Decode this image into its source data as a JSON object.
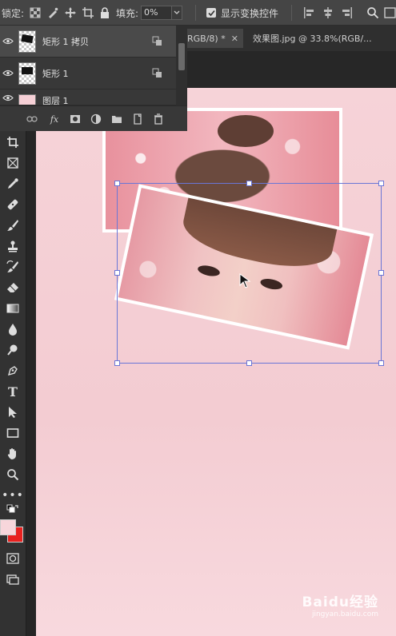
{
  "options_bar": {
    "lock_label": "锁定:",
    "fill_label": "填充:",
    "fill_value": "0%",
    "show_transform_label": "显示变换控件",
    "show_transform_checked": true
  },
  "tabs": [
    {
      "label": "RGB/8) *",
      "active": true
    },
    {
      "label": "效果图.jpg @ 33.8%(RGB/...",
      "active": false
    }
  ],
  "layers": [
    {
      "name": "矩形 1 拷贝",
      "selected": true
    },
    {
      "name": "矩形 1",
      "selected": false
    },
    {
      "name": "图层 1",
      "selected": false
    }
  ],
  "layer_footer_icons": [
    "link-icon",
    "fx-icon",
    "mask-icon",
    "adjustment-icon",
    "folder-icon",
    "new-layer-icon",
    "trash-icon"
  ],
  "tools": [
    "crop-icon",
    "frame-icon",
    "eyedropper-icon",
    "healing-brush-icon",
    "brush-icon",
    "clone-stamp-icon",
    "history-brush-icon",
    "eraser-icon",
    "gradient-icon",
    "blur-icon",
    "dodge-icon",
    "pen-icon",
    "type-icon",
    "path-select-icon",
    "rectangle-icon",
    "hand-icon",
    "zoom-icon",
    "more-icon"
  ],
  "colors": {
    "foreground": "#f7d6db",
    "background": "#e8211f",
    "canvas": "#f5cfd5",
    "selection": "#6a76d6"
  },
  "watermark": {
    "brand": "Baidu经验",
    "url": "jingyan.baidu.com"
  }
}
